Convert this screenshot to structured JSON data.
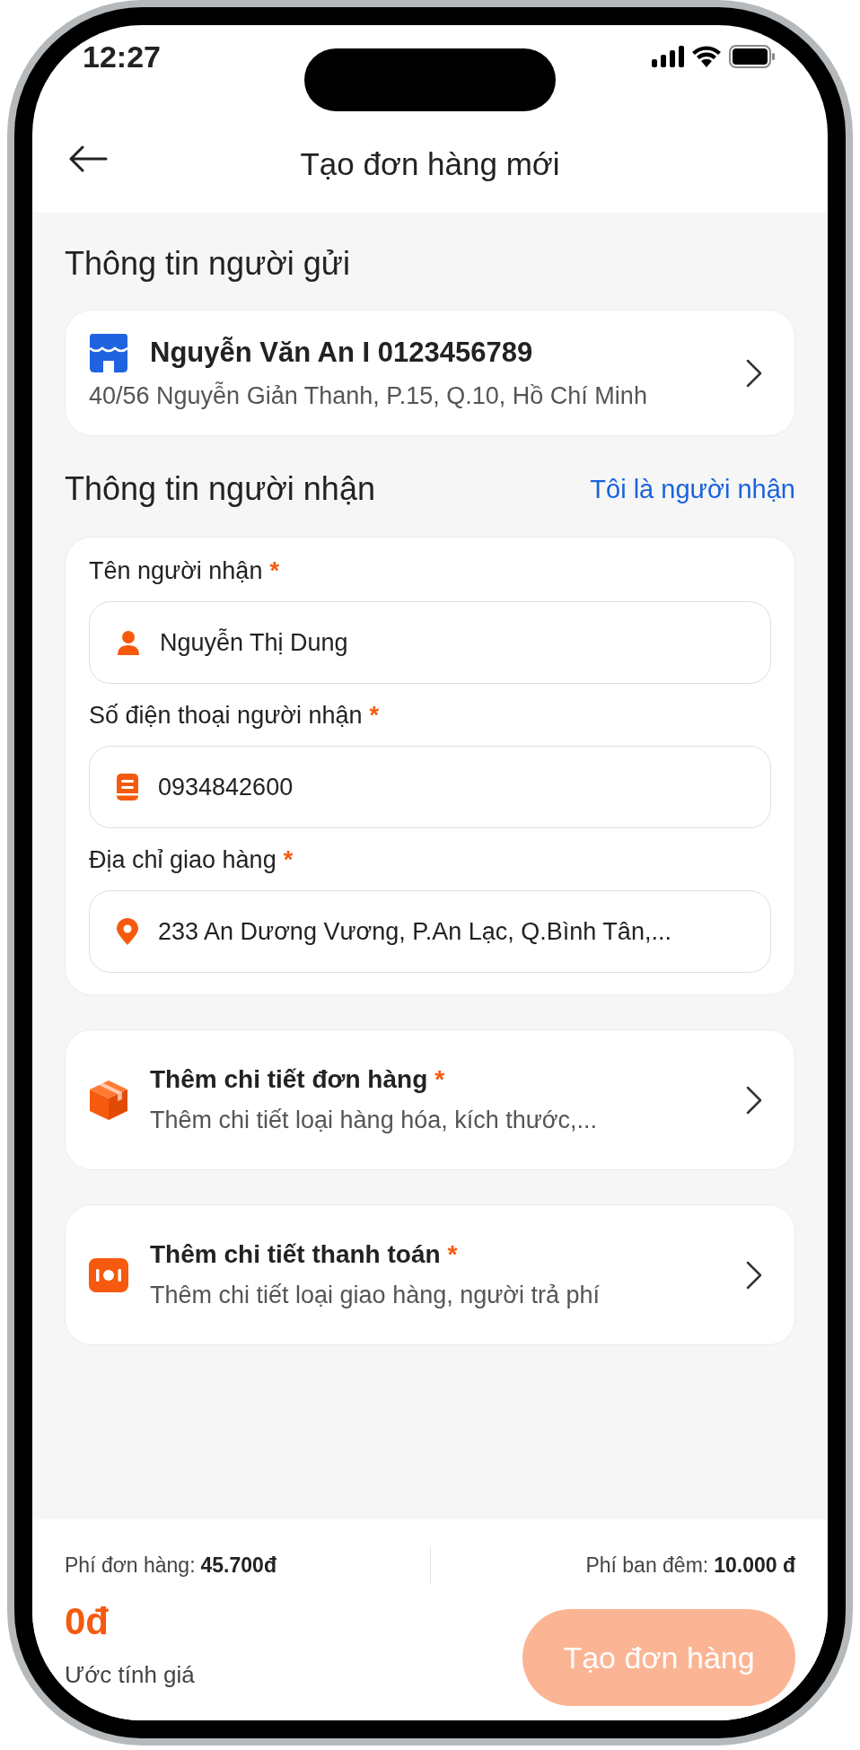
{
  "status_bar": {
    "time": "12:27"
  },
  "header": {
    "title": "Tạo đơn hàng mới"
  },
  "sender": {
    "heading": "Thông tin người gửi",
    "name": "Nguyễn Văn An I 0123456789",
    "address": "40/56 Nguyễn Giản Thanh, P.15, Q.10, Hồ Chí Minh"
  },
  "receiver": {
    "heading": "Thông tin người nhận",
    "link": "Tôi là người nhận",
    "fields": [
      {
        "kind": "person",
        "label": "Tên người nhận",
        "required_mark": "*",
        "value": "Nguyễn Thị Dung"
      },
      {
        "kind": "phone",
        "label": "Số điện thoại người nhận",
        "required_mark": "*",
        "value": "0934842600"
      },
      {
        "kind": "location",
        "label": "Địa chỉ giao hàng",
        "required_mark": "*",
        "value": "233 An Dương Vương, P.An Lạc, Q.Bình Tân,..."
      }
    ]
  },
  "detail_rows": [
    {
      "kind": "package",
      "title": "Thêm chi tiết đơn hàng",
      "required_mark": "*",
      "subtitle": "Thêm chi tiết loại hàng hóa, kích thước,..."
    },
    {
      "kind": "payment",
      "title": "Thêm chi tiết thanh toán",
      "required_mark": "*",
      "subtitle": "Thêm chi tiết loại giao hàng, người trả phí"
    }
  ],
  "footer": {
    "order_fee_label": "Phí đơn hàng:",
    "order_fee": "45.700đ",
    "night_fee_label": "Phí ban đêm:",
    "night_fee": "10.000 đ",
    "total": "0đ",
    "total_label": "Ước tính giá",
    "submit": {
      "label": "Tạo đơn hàng",
      "disabled": true
    }
  }
}
